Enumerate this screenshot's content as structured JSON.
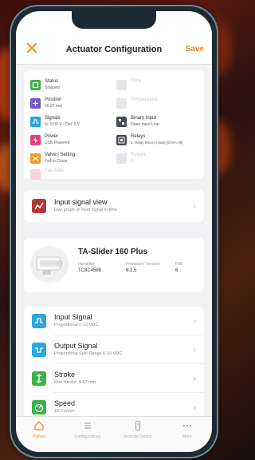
{
  "nav": {
    "title": "Actuator Configuration",
    "save_label": "Save"
  },
  "status_items": [
    {
      "title": "Status",
      "value": "Stopped"
    },
    {
      "title": "Position",
      "value": "50.87 mm"
    },
    {
      "title": "Signals",
      "value": "In: 0.00 V - Out: 0 V"
    },
    {
      "title": "Power",
      "value": "USB Powered"
    },
    {
      "title": "Valve | Setting",
      "value": "Fail-to-Close"
    },
    {
      "title": "Fail-Safe",
      "value": ""
    },
    {
      "title": "Time",
      "value": ""
    },
    {
      "title": "Temperature",
      "value": ""
    },
    {
      "title": "Binary Input",
      "value": "Open Input Line"
    },
    {
      "title": "Relays",
      "value": "1: Relay Bound (state) [DISA-08]"
    },
    {
      "title": "Relays",
      "value": "2: -"
    }
  ],
  "signal_view": {
    "title": "Input signal view",
    "subtitle": "Live graph of input signal in time"
  },
  "device": {
    "name": "TA-Slider 160 Plus",
    "identifier_label": "Identifier",
    "identifier": "TC8C4588",
    "firmware_label": "Firmware Version",
    "firmware": "6.2.5",
    "fw_label": "FW",
    "fw": "6"
  },
  "settings": [
    {
      "title": "Input Signal",
      "subtitle": "Proportional 0-10 VDC"
    },
    {
      "title": "Output Signal",
      "subtitle": "Proportional Split Range 6-10 VDC"
    },
    {
      "title": "Stroke",
      "subtitle": "Max Stroke: 5.87 mm"
    },
    {
      "title": "Speed",
      "subtitle": "10.0 s/mm"
    }
  ],
  "tabs": [
    {
      "label": "Python"
    },
    {
      "label": "Configurations"
    },
    {
      "label": "Remote Control"
    },
    {
      "label": "More"
    }
  ],
  "colors": {
    "accent": "#f08a24",
    "green": "#3fb14a",
    "blue": "#2aa7e0",
    "pink": "#e9407a",
    "orange": "#f39a2c",
    "purple": "#7357c8",
    "dark": "#454a56",
    "red": "#b23a36"
  }
}
